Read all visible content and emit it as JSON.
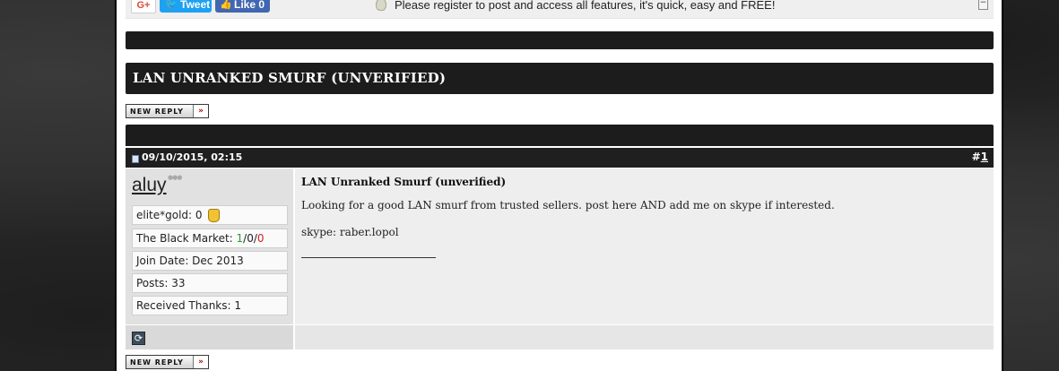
{
  "social": {
    "gplus_label": "G+",
    "tweet_label": "Tweet",
    "like_label": "Like 0"
  },
  "notice": {
    "text": "Please register to post and access all features, it's quick, easy and FREE!",
    "collapse_symbol": "−"
  },
  "thread": {
    "title": "LAN UNRANKED SMURF (UNVERIFIED)",
    "new_reply_label": "NEW REPLY",
    "new_reply_arrow": "»"
  },
  "post": {
    "date": "09/10/2015, 02:15",
    "number_prefix": "#",
    "number": "1",
    "title": "LAN Unranked Smurf (unverified)",
    "body_line1": "Looking for a good LAN smurf from trusted sellers. post here AND add me on skype if interested.",
    "body_line2": "skype: raber.lopol"
  },
  "user": {
    "name": "aluy",
    "elite_gold_label": "elite*gold: 0",
    "black_market_label": "The Black Market: ",
    "bm_positive": "1",
    "bm_sep1": "/",
    "bm_neutral": "0",
    "bm_sep2": "/",
    "bm_negative": "0",
    "join_date": "Join Date: Dec 2013",
    "posts": "Posts: 33",
    "thanks": "Received Thanks: 1"
  },
  "colors": {
    "bar_dark": "#1c1c1c",
    "positive": "#2e9b2e",
    "negative": "#d21f1f",
    "tweet_blue": "#1da1f2",
    "facebook_blue": "#4267b2"
  }
}
